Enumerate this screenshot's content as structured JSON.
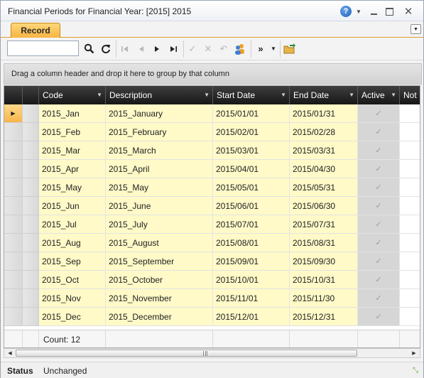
{
  "window": {
    "title": "Financial Periods for Financial Year: [2015] 2015",
    "help": "?",
    "close": "✕"
  },
  "tabs": {
    "record_label": "Record",
    "menu": "▼"
  },
  "toolbar": {
    "search_value": "",
    "icons": [
      "search-icon",
      "refresh-icon",
      "first-icon",
      "previous-icon",
      "next-icon",
      "last-icon",
      "confirm-icon",
      "cancel-icon",
      "undo-icon",
      "users-icon",
      "more-icon",
      "export-icon"
    ]
  },
  "group_panel": {
    "text": "Drag a column header and drop it here to group by that column"
  },
  "grid": {
    "columns": [
      "Code",
      "Description",
      "Start Date",
      "End Date",
      "Active",
      "Not"
    ],
    "rows": [
      {
        "code": "2015_Jan",
        "description": "2015_January",
        "start": "2015/01/01",
        "end": "2015/01/31",
        "active": true
      },
      {
        "code": "2015_Feb",
        "description": "2015_February",
        "start": "2015/02/01",
        "end": "2015/02/28",
        "active": true
      },
      {
        "code": "2015_Mar",
        "description": "2015_March",
        "start": "2015/03/01",
        "end": "2015/03/31",
        "active": true
      },
      {
        "code": "2015_Apr",
        "description": "2015_April",
        "start": "2015/04/01",
        "end": "2015/04/30",
        "active": true
      },
      {
        "code": "2015_May",
        "description": "2015_May",
        "start": "2015/05/01",
        "end": "2015/05/31",
        "active": true
      },
      {
        "code": "2015_Jun",
        "description": "2015_June",
        "start": "2015/06/01",
        "end": "2015/06/30",
        "active": true
      },
      {
        "code": "2015_Jul",
        "description": "2015_July",
        "start": "2015/07/01",
        "end": "2015/07/31",
        "active": true
      },
      {
        "code": "2015_Aug",
        "description": "2015_August",
        "start": "2015/08/01",
        "end": "2015/08/31",
        "active": true
      },
      {
        "code": "2015_Sep",
        "description": "2015_September",
        "start": "2015/09/01",
        "end": "2015/09/30",
        "active": true
      },
      {
        "code": "2015_Oct",
        "description": "2015_October",
        "start": "2015/10/01",
        "end": "2015/10/31",
        "active": true
      },
      {
        "code": "2015_Nov",
        "description": "2015_November",
        "start": "2015/11/01",
        "end": "2015/11/30",
        "active": true
      },
      {
        "code": "2015_Dec",
        "description": "2015_December",
        "start": "2015/12/01",
        "end": "2015/12/31",
        "active": true
      }
    ],
    "current_row_marker": "▶",
    "checkmark": "✓",
    "footer_count": "Count: 12"
  },
  "status": {
    "label": "Status",
    "value": "Unchanged"
  },
  "colors": {
    "accent": "#f7b33f",
    "row_highlight": "#fffac8",
    "header": "#1f1f1f"
  }
}
